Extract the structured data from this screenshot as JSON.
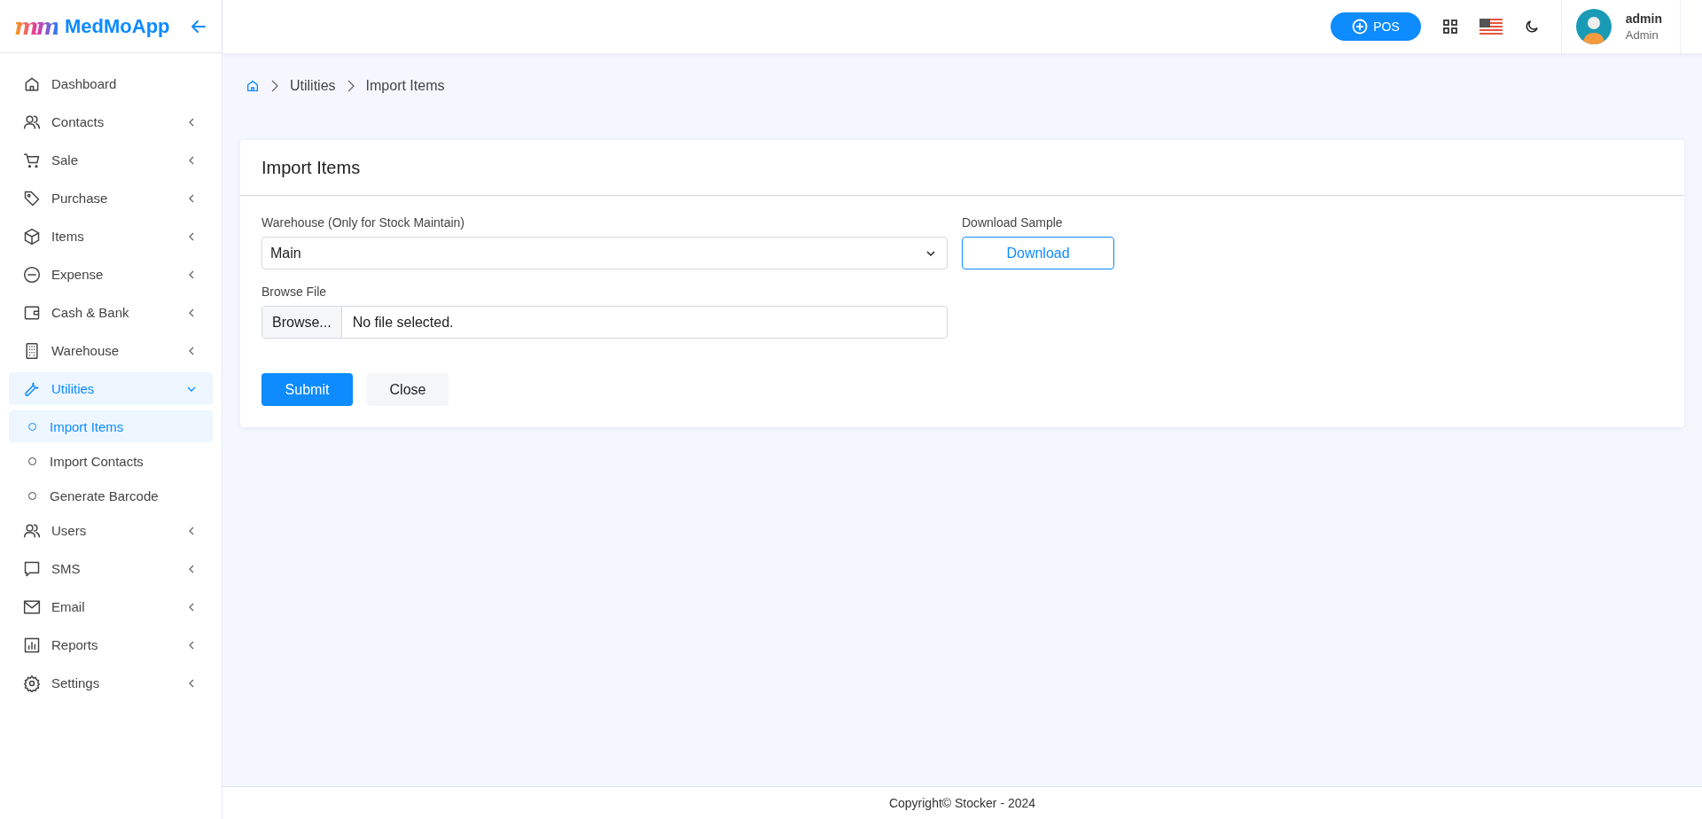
{
  "brand": {
    "name": "MedMoApp",
    "logo_text": "mm"
  },
  "header": {
    "pos_button": "POS",
    "user": {
      "name": "admin",
      "role": "Admin"
    }
  },
  "sidebar": {
    "items": [
      {
        "label": "Dashboard",
        "kind": "link",
        "selected": false
      },
      {
        "label": "Contacts",
        "kind": "group",
        "selected": false,
        "expanded": false
      },
      {
        "label": "Sale",
        "kind": "group",
        "selected": false,
        "expanded": false
      },
      {
        "label": "Purchase",
        "kind": "group",
        "selected": false,
        "expanded": false
      },
      {
        "label": "Items",
        "kind": "group",
        "selected": false,
        "expanded": false
      },
      {
        "label": "Expense",
        "kind": "group",
        "selected": false,
        "expanded": false
      },
      {
        "label": "Cash & Bank",
        "kind": "group",
        "selected": false,
        "expanded": false
      },
      {
        "label": "Warehouse",
        "kind": "group",
        "selected": false,
        "expanded": false
      },
      {
        "label": "Utilities",
        "kind": "group",
        "selected": true,
        "expanded": true,
        "children": [
          {
            "label": "Import Items",
            "selected": true
          },
          {
            "label": "Import Contacts",
            "selected": false
          },
          {
            "label": "Generate Barcode",
            "selected": false
          }
        ]
      },
      {
        "label": "Users",
        "kind": "group",
        "selected": false,
        "expanded": false
      },
      {
        "label": "SMS",
        "kind": "group",
        "selected": false,
        "expanded": false
      },
      {
        "label": "Email",
        "kind": "group",
        "selected": false,
        "expanded": false
      },
      {
        "label": "Reports",
        "kind": "group",
        "selected": false,
        "expanded": false
      },
      {
        "label": "Settings",
        "kind": "group",
        "selected": false,
        "expanded": false
      }
    ]
  },
  "breadcrumb": [
    "Utilities",
    "Import Items"
  ],
  "card": {
    "title": "Import Items",
    "warehouse": {
      "label": "Warehouse (Only for Stock Maintain)",
      "value": "Main"
    },
    "download": {
      "label": "Download Sample",
      "button": "Download"
    },
    "file": {
      "label": "Browse File",
      "button": "Browse...",
      "value": "No file selected."
    },
    "buttons": [
      "Submit",
      "Close"
    ]
  },
  "footer": "Copyright© Stocker - 2024"
}
